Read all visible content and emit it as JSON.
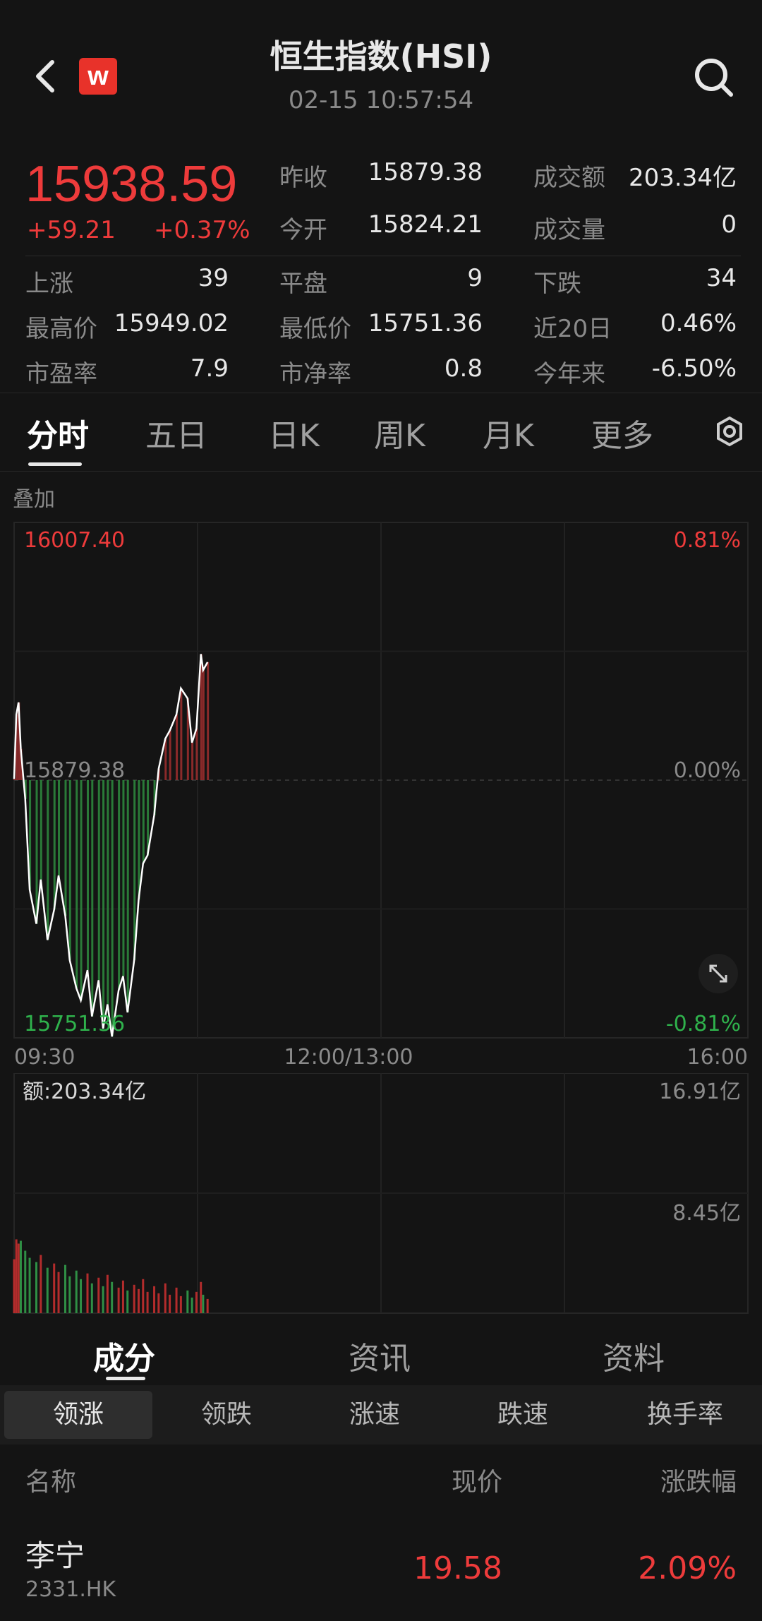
{
  "header": {
    "title": "恒生指数(HSI)",
    "datetime": "02-15 10:57:54",
    "logo_letter": "w",
    "icons": {
      "back": "chevron-left-icon",
      "search": "search-icon"
    }
  },
  "quote": {
    "price": "15938.59",
    "change": "+59.21",
    "change_pct": "+0.37%",
    "fields": [
      {
        "label": "昨收",
        "value": "15879.38",
        "color": "#e8e8e8"
      },
      {
        "label": "成交额",
        "value": "203.34亿",
        "color": "#e8e8e8"
      },
      {
        "label": "今开",
        "value": "15824.21",
        "color": "#e8e8e8"
      },
      {
        "label": "成交量",
        "value": "0",
        "color": "#e8e8e8"
      },
      {
        "label": "上涨",
        "value": "39",
        "color": "#e8e8e8"
      },
      {
        "label": "平盘",
        "value": "9",
        "color": "#e8e8e8"
      },
      {
        "label": "下跌",
        "value": "34",
        "color": "#e8e8e8"
      },
      {
        "label": "最高价",
        "value": "15949.02",
        "color": "#e8e8e8"
      },
      {
        "label": "最低价",
        "value": "15751.36",
        "color": "#e8e8e8"
      },
      {
        "label": "近20日",
        "value": "0.46%",
        "color": "#e8e8e8"
      },
      {
        "label": "市盈率",
        "value": "7.9",
        "color": "#e8e8e8"
      },
      {
        "label": "市净率",
        "value": "0.8",
        "color": "#e8e8e8"
      },
      {
        "label": "今年来",
        "value": "-6.50%",
        "color": "#e8e8e8"
      }
    ]
  },
  "period_tabs": [
    {
      "label": "分时",
      "active": true
    },
    {
      "label": "五日",
      "active": false
    },
    {
      "label": "日K",
      "active": false
    },
    {
      "label": "周K",
      "active": false
    },
    {
      "label": "月K",
      "active": false
    },
    {
      "label": "更多",
      "active": false
    }
  ],
  "settings_icon": "gear-icon",
  "overlay_label": "叠加",
  "chart_data": [
    {
      "type": "line",
      "title": "",
      "y_labels_left": [
        "16007.40",
        "15879.38",
        "15751.36"
      ],
      "y_labels_right": [
        "0.81%",
        "0.00%",
        "-0.81%"
      ],
      "x_labels": [
        "09:30",
        "12:00/13:00",
        "16:00"
      ],
      "ylim": [
        15751.36,
        16007.4
      ],
      "base": 15879.38,
      "series": [
        {
          "x": [
            "09:30",
            "09:31",
            "09:32",
            "09:33",
            "09:35",
            "09:37",
            "09:40",
            "09:42",
            "09:45",
            "09:48",
            "09:50",
            "09:53",
            "09:55",
            "09:58",
            "10:00",
            "10:03",
            "10:05",
            "10:08",
            "10:10",
            "10:12",
            "10:14",
            "10:17",
            "10:19",
            "10:21",
            "10:24",
            "10:26",
            "10:28",
            "10:30",
            "10:33",
            "10:35",
            "10:38",
            "10:40",
            "10:43",
            "10:45",
            "10:48",
            "10:50",
            "10:52",
            "10:54",
            "10:55",
            "10:57"
          ],
          "values": [
            15880,
            15912,
            15918,
            15895,
            15870,
            15825,
            15808,
            15830,
            15800,
            15815,
            15832,
            15812,
            15790,
            15776,
            15770,
            15785,
            15762,
            15780,
            15756,
            15768,
            15752,
            15775,
            15782,
            15764,
            15790,
            15820,
            15838,
            15842,
            15862,
            15885,
            15900,
            15904,
            15912,
            15925,
            15920,
            15898,
            15905,
            15942,
            15934,
            15938
          ]
        }
      ]
    },
    {
      "type": "bar",
      "title": "",
      "label": "额:203.34亿",
      "y_labels_right": [
        "16.91亿",
        "8.45亿"
      ],
      "ylim": [
        0,
        16.91
      ],
      "series": [
        {
          "name": "成交额(亿)",
          "values": [
            3.8,
            5.2,
            4.9,
            5.1,
            4.4,
            3.9,
            3.6,
            4.1,
            3.2,
            3.5,
            2.9,
            3.4,
            2.6,
            3.0,
            2.4,
            2.8,
            2.1,
            2.5,
            1.9,
            2.7,
            2.2,
            1.8,
            2.3,
            1.6,
            2.0,
            1.7,
            2.4,
            1.5,
            1.9,
            1.4,
            2.1,
            1.3,
            1.8,
            1.2,
            1.6,
            1.1,
            1.5,
            2.2,
            1.3,
            1.0
          ]
        }
      ]
    }
  ],
  "chart_icons": {
    "expand": "expand-icon"
  },
  "section_tabs": [
    {
      "label": "成分",
      "active": true
    },
    {
      "label": "资讯",
      "active": false
    },
    {
      "label": "资料",
      "active": false
    }
  ],
  "sub_tabs": [
    {
      "label": "领涨",
      "active": true
    },
    {
      "label": "领跌",
      "active": false
    },
    {
      "label": "涨速",
      "active": false
    },
    {
      "label": "跌速",
      "active": false
    },
    {
      "label": "换手率",
      "active": false
    }
  ],
  "list": {
    "headers": {
      "name": "名称",
      "price": "现价",
      "change": "涨跌幅"
    },
    "rows": [
      {
        "name": "李宁",
        "code": "2331.HK",
        "price": "19.58",
        "change": "2.09%"
      }
    ]
  },
  "colors": {
    "up": "#ee3b3b",
    "down": "#2fb24c",
    "background": "#141414",
    "line": "#ffffff"
  }
}
